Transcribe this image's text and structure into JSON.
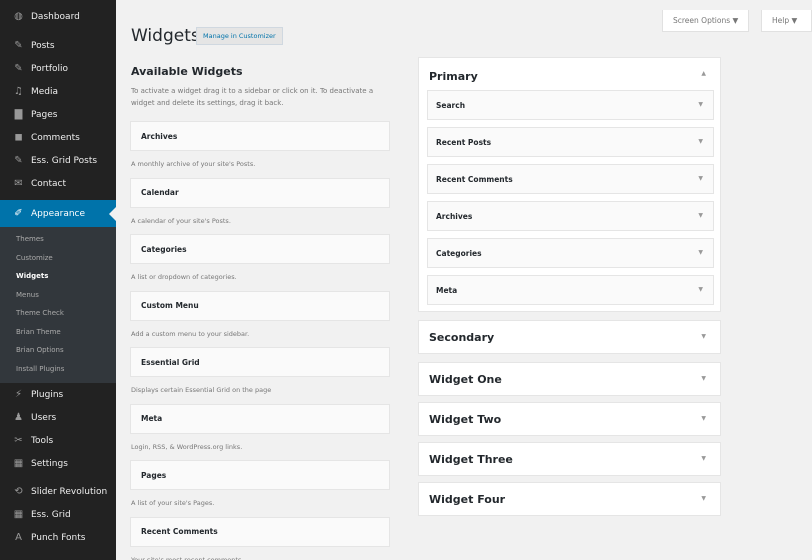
{
  "sidebar": {
    "items": [
      {
        "label": "Dashboard",
        "icon": "dashboard-icon",
        "glyph": "◍"
      },
      {
        "label": "Posts",
        "icon": "pin-icon",
        "glyph": "✎"
      },
      {
        "label": "Portfolio",
        "icon": "pin-icon",
        "glyph": "✎"
      },
      {
        "label": "Media",
        "icon": "media-icon",
        "glyph": "♫"
      },
      {
        "label": "Pages",
        "icon": "page-icon",
        "glyph": "▇"
      },
      {
        "label": "Comments",
        "icon": "comment-icon",
        "glyph": "◼"
      },
      {
        "label": "Ess. Grid Posts",
        "icon": "pin-icon",
        "glyph": "✎"
      },
      {
        "label": "Contact",
        "icon": "mail-icon",
        "glyph": "✉"
      }
    ],
    "appearance": {
      "label": "Appearance",
      "icon": "paintbrush-icon",
      "glyph": "✐"
    },
    "submenu": [
      "Themes",
      "Customize",
      "Widgets",
      "Menus",
      "Theme Check",
      "Brian Theme",
      "Brian Options",
      "Install Plugins"
    ],
    "current_sub": "Widgets",
    "items2": [
      {
        "label": "Plugins",
        "icon": "plugin-icon",
        "glyph": "⚡"
      },
      {
        "label": "Users",
        "icon": "user-icon",
        "glyph": "♟"
      },
      {
        "label": "Tools",
        "icon": "wrench-icon",
        "glyph": "✂"
      },
      {
        "label": "Settings",
        "icon": "settings-icon",
        "glyph": "▦"
      }
    ],
    "items3": [
      {
        "label": "Slider Revolution",
        "icon": "refresh-icon",
        "glyph": "⟲"
      },
      {
        "label": "Ess. Grid",
        "icon": "grid-icon",
        "glyph": "▦"
      },
      {
        "label": "Punch Fonts",
        "icon": "font-icon",
        "glyph": "A"
      }
    ]
  },
  "header": {
    "title": "Widgets",
    "manage_button": "Manage in Customizer",
    "screen_options": "Screen Options ▼",
    "help": "Help ▼"
  },
  "available": {
    "title": "Available Widgets",
    "description": "To activate a widget drag it to a sidebar or click on it. To deactivate a widget and delete its settings, drag it back.",
    "widgets": [
      {
        "name": "Archives",
        "desc": "A monthly archive of your site's Posts."
      },
      {
        "name": "Calendar",
        "desc": "A calendar of your site's Posts."
      },
      {
        "name": "Categories",
        "desc": "A list or dropdown of categories."
      },
      {
        "name": "Custom Menu",
        "desc": "Add a custom menu to your sidebar."
      },
      {
        "name": "Essential Grid",
        "desc": "Displays certain Essential Grid on the page"
      },
      {
        "name": "Meta",
        "desc": "Login, RSS, & WordPress.org links."
      },
      {
        "name": "Pages",
        "desc": "A list of your site's Pages."
      },
      {
        "name": "Recent Comments",
        "desc": "Your site's most recent comments."
      }
    ]
  },
  "areas": {
    "primary": {
      "title": "Primary",
      "widgets": [
        "Search",
        "Recent Posts",
        "Recent Comments",
        "Archives",
        "Categories",
        "Meta"
      ]
    },
    "others": [
      "Secondary",
      "Widget One",
      "Widget Two",
      "Widget Three",
      "Widget Four"
    ]
  }
}
